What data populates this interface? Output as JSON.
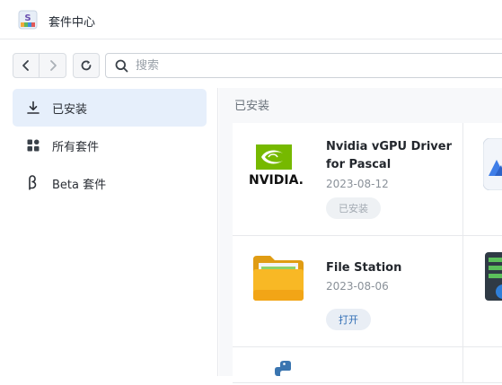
{
  "window": {
    "title": "套件中心",
    "icon": "package-center-icon"
  },
  "toolbar": {
    "back_icon": "chevron-left-icon",
    "forward_icon": "chevron-right-icon",
    "refresh_icon": "refresh-icon",
    "search_placeholder": "搜索"
  },
  "sidebar": {
    "items": [
      {
        "label": "已安装",
        "icon": "download-icon",
        "active": true
      },
      {
        "label": "所有套件",
        "icon": "grid-icon",
        "active": false
      },
      {
        "label": "Beta 套件",
        "icon": "beta-icon",
        "active": false
      }
    ]
  },
  "main": {
    "section_title": "已安装",
    "cards": [
      {
        "name": "Nvidia vGPU Driver for Pascal",
        "date": "2023-08-12",
        "button": "已安装",
        "button_state": "disabled",
        "icon": "nvidia-logo"
      },
      {
        "name": "File Station",
        "date": "2023-08-06",
        "button": "打开",
        "button_state": "primary",
        "icon": "folder-icon"
      }
    ],
    "nvidia_logo_text": "NVIDIA."
  },
  "colors": {
    "accent": "#2f6db5",
    "active_bg": "#e6effb",
    "nvidia_green": "#76b900",
    "folder": "#f6b21a"
  }
}
